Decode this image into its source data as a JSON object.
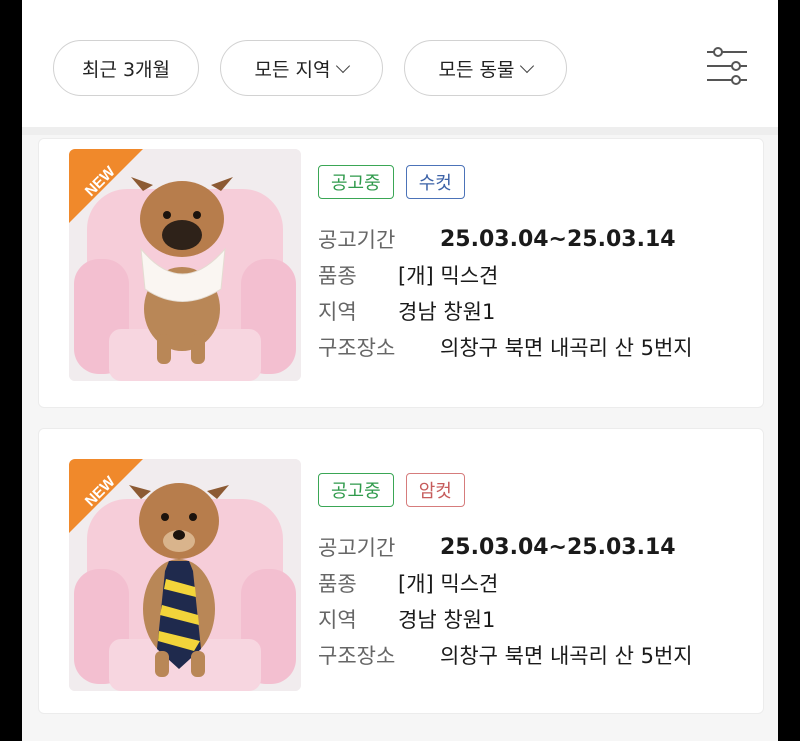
{
  "filters": {
    "period": "최근 3개월",
    "region": "모든 지역",
    "animal": "모든 동물"
  },
  "colors": {
    "tag_green": "#2f9a4b",
    "tag_blue": "#3d63a8",
    "tag_red": "#c65c5c",
    "new_badge": "#f0892b"
  },
  "listings": [
    {
      "badge": "NEW",
      "status_tag": "공고중",
      "sex_tag": "수컷",
      "period_label": "공고기간",
      "period_value": "25.03.04~25.03.14",
      "breed_label": "품종",
      "breed_value": "[개] 믹스견",
      "region_label": "지역",
      "region_value": "경남 창원1",
      "rescue_label": "구조장소",
      "rescue_value": "의창구 북면 내곡리 산 5번지"
    },
    {
      "badge": "NEW",
      "status_tag": "공고중",
      "sex_tag": "암컷",
      "period_label": "공고기간",
      "period_value": "25.03.04~25.03.14",
      "breed_label": "품종",
      "breed_value": "[개] 믹스견",
      "region_label": "지역",
      "region_value": "경남 창원1",
      "rescue_label": "구조장소",
      "rescue_value": "의창구 북면 내곡리 산 5번지"
    }
  ]
}
